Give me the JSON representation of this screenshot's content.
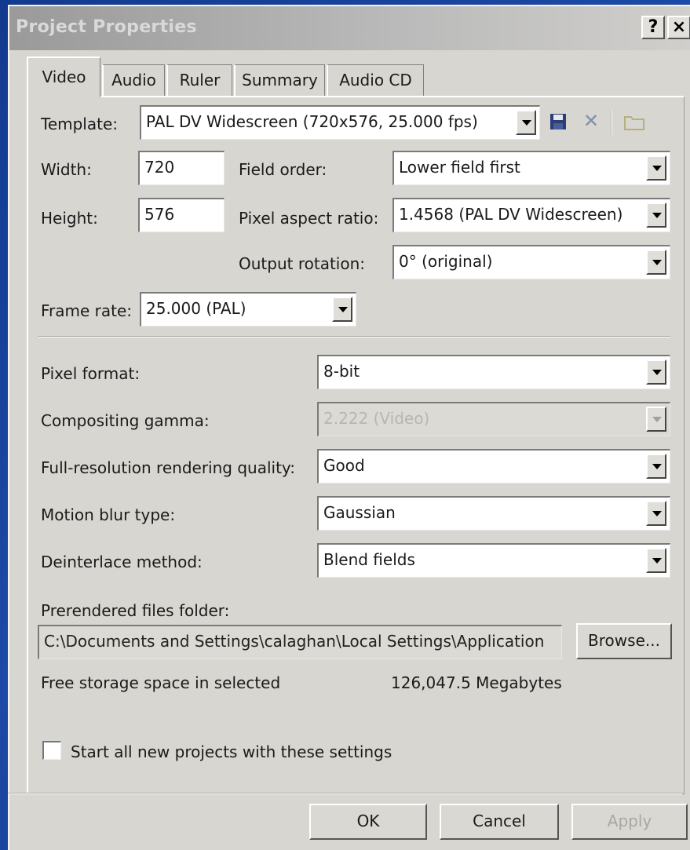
{
  "window": {
    "title": "Project Properties",
    "help_label": "?",
    "close_label": "×"
  },
  "tabs": [
    "Video",
    "Audio",
    "Ruler",
    "Summary",
    "Audio CD"
  ],
  "video": {
    "template_label": "Template:",
    "template_value": "PAL DV Widescreen (720x576, 25.000 fps)",
    "width_label": "Width:",
    "width_value": "720",
    "height_label": "Height:",
    "height_value": "576",
    "field_order_label": "Field order:",
    "field_order_value": "Lower field first",
    "pixel_aspect_label": "Pixel aspect ratio:",
    "pixel_aspect_value": "1.4568 (PAL DV Widescreen)",
    "output_rotation_label": "Output rotation:",
    "output_rotation_value": "0° (original)",
    "frame_rate_label": "Frame rate:",
    "frame_rate_value": "25.000 (PAL)",
    "pixel_format_label": "Pixel format:",
    "pixel_format_value": "8-bit",
    "compositing_gamma_label": "Compositing gamma:",
    "compositing_gamma_value": "2.222 (Video)",
    "render_quality_label": "Full-resolution rendering quality:",
    "render_quality_value": "Good",
    "motion_blur_label": "Motion blur type:",
    "motion_blur_value": "Gaussian",
    "deinterlace_label": "Deinterlace method:",
    "deinterlace_value": "Blend fields",
    "prerender_folder_label": "Prerendered files folder:",
    "prerender_folder_value": "C:\\Documents and Settings\\calaghan\\Local Settings\\Application",
    "browse_label": "Browse...",
    "free_space_label": "Free storage space in selected",
    "free_space_value": "126,047.5 Megabytes",
    "start_new_label": "Start all new projects with these settings"
  },
  "buttons": {
    "ok": "OK",
    "cancel": "Cancel",
    "apply": "Apply"
  },
  "icons": {
    "save": "save-icon",
    "delete": "delete-icon",
    "folder": "folder-icon"
  }
}
